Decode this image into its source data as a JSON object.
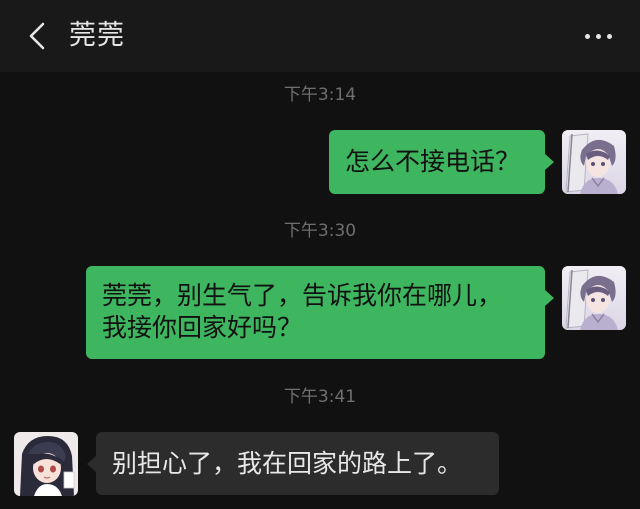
{
  "header": {
    "title": "莞莞",
    "back_icon": "chevron-left-icon",
    "more_icon": "more-horizontal-icon"
  },
  "messages": [
    {
      "type": "timestamp",
      "text": "下午3:14"
    },
    {
      "type": "message",
      "sender": "me",
      "text": "怎么不接电话？"
    },
    {
      "type": "timestamp",
      "text": "下午3:30"
    },
    {
      "type": "message",
      "sender": "me",
      "lines": [
        "莞莞，别生气了，告诉我你在哪儿，",
        "我接你回家好吗？"
      ]
    },
    {
      "type": "timestamp",
      "text": "下午3:41"
    },
    {
      "type": "message",
      "sender": "other",
      "text": "别担心了，我在回家的路上了。"
    }
  ],
  "colors": {
    "background": "#111111",
    "header": "#191919",
    "my_bubble": "#3eb55f",
    "their_bubble": "#2c2c2c"
  }
}
